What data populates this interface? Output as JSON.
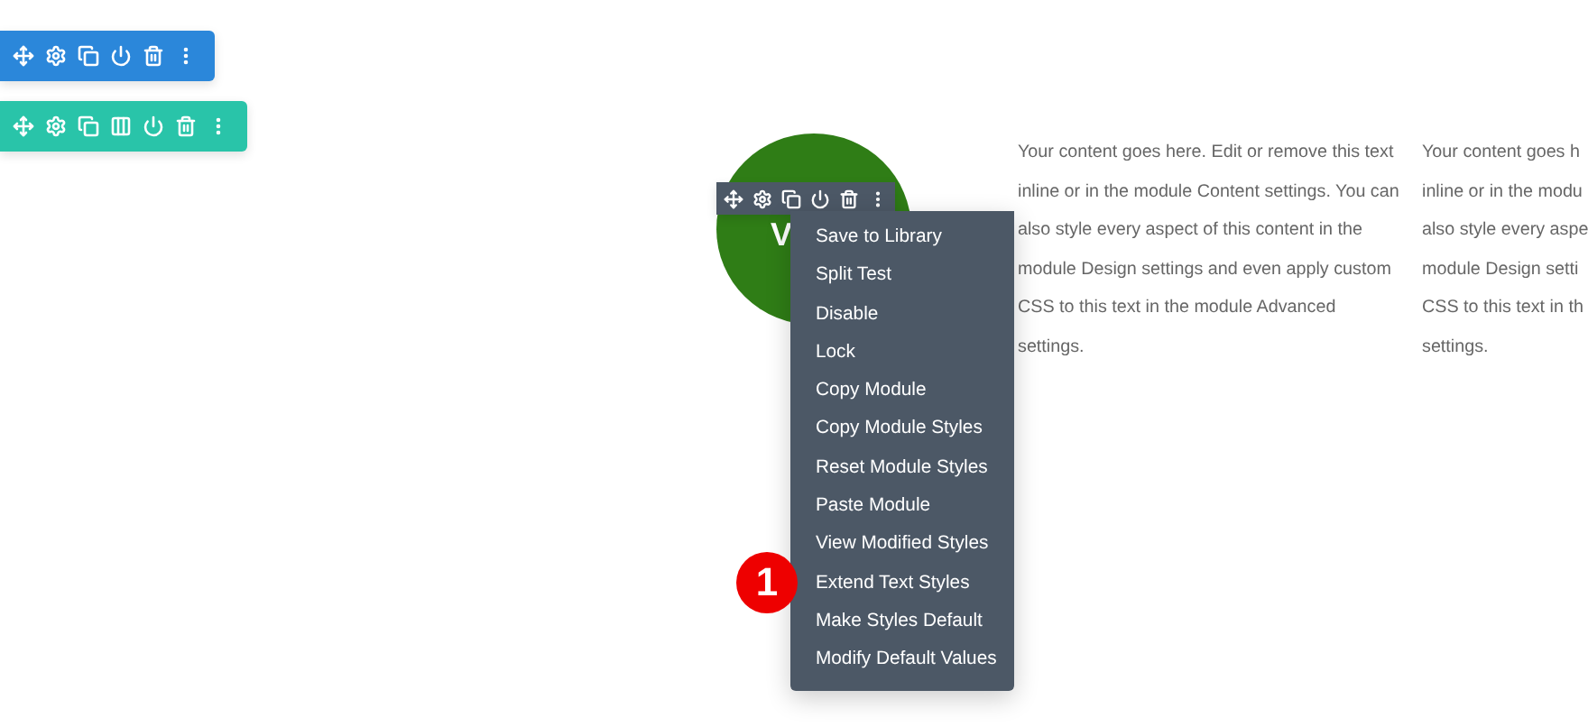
{
  "toolbars": [
    {
      "kind": "section"
    },
    {
      "kind": "row"
    }
  ],
  "module": {
    "heading": "V",
    "toolbar": {
      "kind": "module"
    }
  },
  "columns": [
    {
      "lines": [
        "Your content goes here. Edit or remove this text",
        "inline or in the module Content settings. You can",
        "also style every aspect of this content in the",
        "module Design settings and even apply custom",
        "CSS to this text in the module Advanced",
        "settings."
      ]
    },
    {
      "lines": [
        "Your content goes h",
        "inline or in the modu",
        "also style every aspe",
        "module Design setti",
        "CSS to this text in th",
        "settings."
      ]
    }
  ],
  "context_menu": {
    "items": [
      "Save to Library",
      "Split Test",
      "Disable",
      "Lock",
      "Copy Module",
      "Copy Module Styles",
      "Reset Module Styles",
      "Paste Module",
      "View Modified Styles",
      "Extend Text Styles",
      "Make Styles Default",
      "Modify Default Values"
    ]
  },
  "step_badge": "1"
}
